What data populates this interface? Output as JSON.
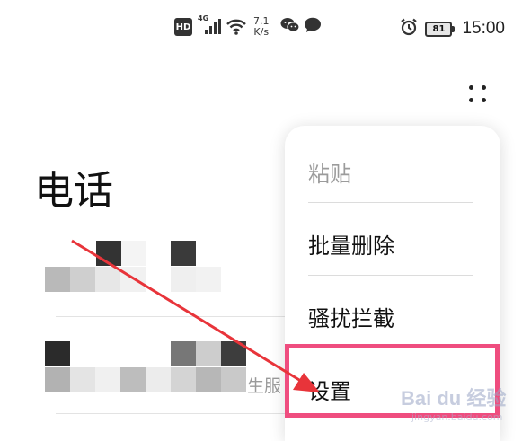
{
  "status_bar": {
    "hd": "HD",
    "network": "4G",
    "speed_value": "7.1",
    "speed_unit": "K/s",
    "battery": "81",
    "time": "15:00",
    "icons": [
      "hd-icon",
      "signal-icon",
      "wifi-icon",
      "wechat-icon",
      "message-icon",
      "alarm-icon",
      "battery-icon"
    ]
  },
  "toolbar": {
    "more_icon": "more-dots-icon"
  },
  "page": {
    "title": "电话"
  },
  "contacts": {
    "row2_sub_fragment": "生服"
  },
  "menu": {
    "items": [
      {
        "label": "粘贴",
        "enabled": false
      },
      {
        "label": "批量删除",
        "enabled": true
      },
      {
        "label": "骚扰拦截",
        "enabled": true
      },
      {
        "label": "设置",
        "enabled": true
      }
    ]
  },
  "annotation": {
    "highlight_color": "#ef4d7f",
    "arrow_color": "#e8343a"
  },
  "watermark": {
    "text": "Bai du 经验",
    "sub": "jingyan.baidu.com"
  }
}
